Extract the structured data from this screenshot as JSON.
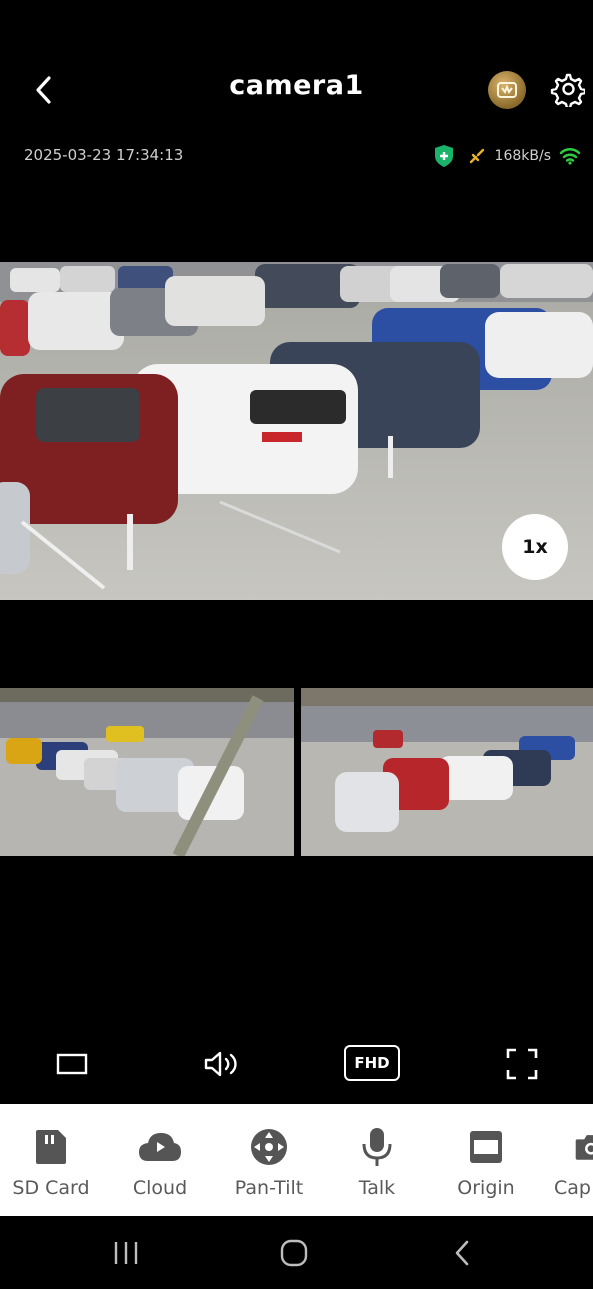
{
  "header": {
    "title": "camera1",
    "back_icon": "chevron-left-icon",
    "badge_icon": "vip-badge-icon",
    "settings_icon": "gear-icon"
  },
  "status_bar": {
    "timestamp": "2025-03-23 17:34:13",
    "bitrate": "168kB/s",
    "colors": {
      "shield": "#1bb36a",
      "signal": "#2ecc40",
      "bolt": "#e6b325"
    }
  },
  "video": {
    "zoom_label": "1x"
  },
  "controls": {
    "quality_label": "FHD"
  },
  "toolbar": {
    "items": [
      {
        "label": "SD Card",
        "icon": "sd-card-icon"
      },
      {
        "label": "Cloud",
        "icon": "cloud-icon"
      },
      {
        "label": "Pan-Tilt",
        "icon": "pan-tilt-icon"
      },
      {
        "label": "Talk",
        "icon": "microphone-icon"
      },
      {
        "label": "Origin",
        "icon": "origin-icon"
      },
      {
        "label": "Cap",
        "icon": "camera-icon"
      }
    ]
  }
}
